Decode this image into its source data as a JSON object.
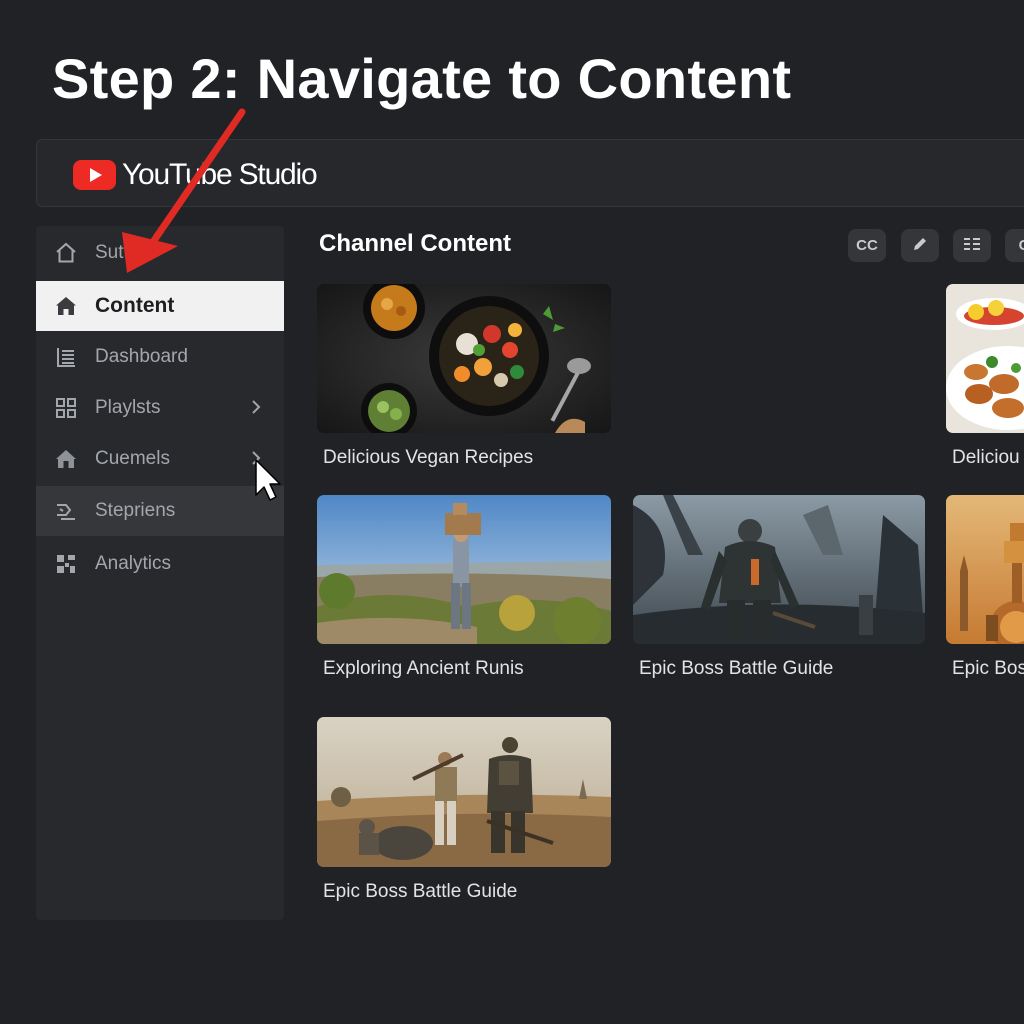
{
  "step_title": "Step 2: Navigate to Content",
  "app": {
    "name": "YouTube Studio",
    "brand_color": "#ee2a24"
  },
  "sidebar": {
    "items": [
      {
        "label": "Sutt",
        "icon": "home-outline-icon",
        "state": "normal"
      },
      {
        "label": "Content",
        "icon": "home-filled-icon",
        "state": "active"
      },
      {
        "label": "Dashboard",
        "icon": "list-icon",
        "state": "normal"
      },
      {
        "label": "Playlsts",
        "icon": "grid-icon",
        "state": "normal",
        "has_chevron": true
      },
      {
        "label": "Cuemels",
        "icon": "house-icon",
        "state": "normal",
        "has_chevron": true
      },
      {
        "label": "Stepriens",
        "icon": "steps-icon",
        "state": "hover"
      },
      {
        "label": "Analytics",
        "icon": "analytics-icon",
        "state": "normal"
      }
    ]
  },
  "main": {
    "section_title": "Channel Content",
    "toolbar": {
      "cc_label": "CC",
      "edit_icon": "pencil-icon",
      "list_icon": "lines-icon",
      "more_label": "C"
    },
    "videos": [
      {
        "title": "Delicious Vegan Recipes",
        "thumbnail": "vegan-food-bowl-thumbnail"
      },
      {
        "title": "Deliciou",
        "thumbnail": "food-plate-thumbnail"
      },
      {
        "title": "Exploring Ancient Runis",
        "thumbnail": "hiker-ruins-thumbnail"
      },
      {
        "title": "Epic Boss Battle Guide",
        "thumbnail": "armored-warrior-thumbnail"
      },
      {
        "title": "Epic Bos",
        "thumbnail": "steampunk-tower-thumbnail"
      },
      {
        "title": "Epic Boss Battle Guide",
        "thumbnail": "soldiers-field-thumbnail"
      }
    ]
  },
  "annotation": {
    "arrow_color": "#e02a24",
    "arrow_target": "Content"
  }
}
